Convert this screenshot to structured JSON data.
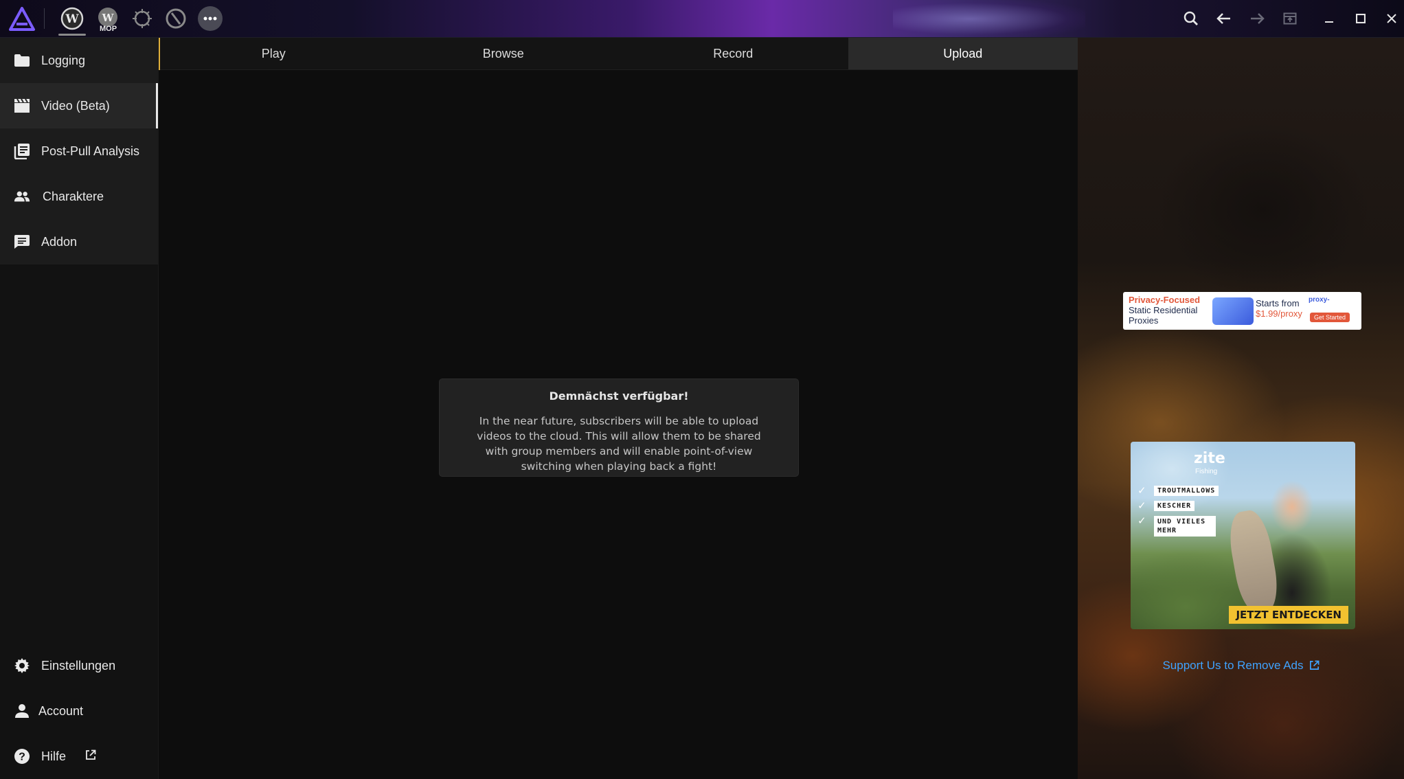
{
  "topbar": {
    "mop_label": "MOP",
    "icons": [
      "app-logo-icon",
      "wow-retail-icon",
      "wow-mop-icon",
      "ffxiv-icon",
      "destiny-icon",
      "more-games-icon",
      "search-icon",
      "back-arrow-icon",
      "forward-arrow-icon",
      "popout-icon",
      "minimize-icon",
      "maximize-icon",
      "close-icon"
    ]
  },
  "sidebar": {
    "items": [
      {
        "label": "Logging",
        "icon": "folder-icon"
      },
      {
        "label": "Video (Beta)",
        "icon": "clapperboard-icon"
      },
      {
        "label": "Post-Pull Analysis",
        "icon": "document-stack-icon"
      },
      {
        "label": "Charaktere",
        "icon": "people-icon"
      },
      {
        "label": "Addon",
        "icon": "chat-list-icon"
      }
    ],
    "bottom": [
      {
        "label": "Einstellungen",
        "icon": "gear-icon"
      },
      {
        "label": "Account",
        "icon": "person-icon"
      },
      {
        "label": "Hilfe",
        "icon": "help-icon"
      }
    ]
  },
  "tabs": [
    {
      "label": "Play"
    },
    {
      "label": "Browse"
    },
    {
      "label": "Record"
    },
    {
      "label": "Upload"
    }
  ],
  "notice": {
    "title": "Demnächst verfügbar!",
    "body": "In the near future, subscribers will be able to upload videos to the cloud. This will allow them to be shared with group members and will enable point-of-view switching when playing back a fight!"
  },
  "ads": {
    "proxy": {
      "headline": "Privacy-Focused",
      "subline": "Static Residential Proxies",
      "price_prefix": "Starts from",
      "price": "$1.99/proxy",
      "brand": "proxy-",
      "cta": "Get Started"
    },
    "fishing": {
      "brand": "zite",
      "brand_sub": "Fishing",
      "bullets": [
        "TROUTMALLOWS",
        "KESCHER",
        "UND VIELES MEHR"
      ],
      "cta": "JETZT ENTDECKEN"
    }
  },
  "support_link": "Support Us to Remove Ads",
  "colors": {
    "accent_tab": "#e0b03a",
    "link": "#3fa3ff",
    "logo": "#7b5cff"
  }
}
